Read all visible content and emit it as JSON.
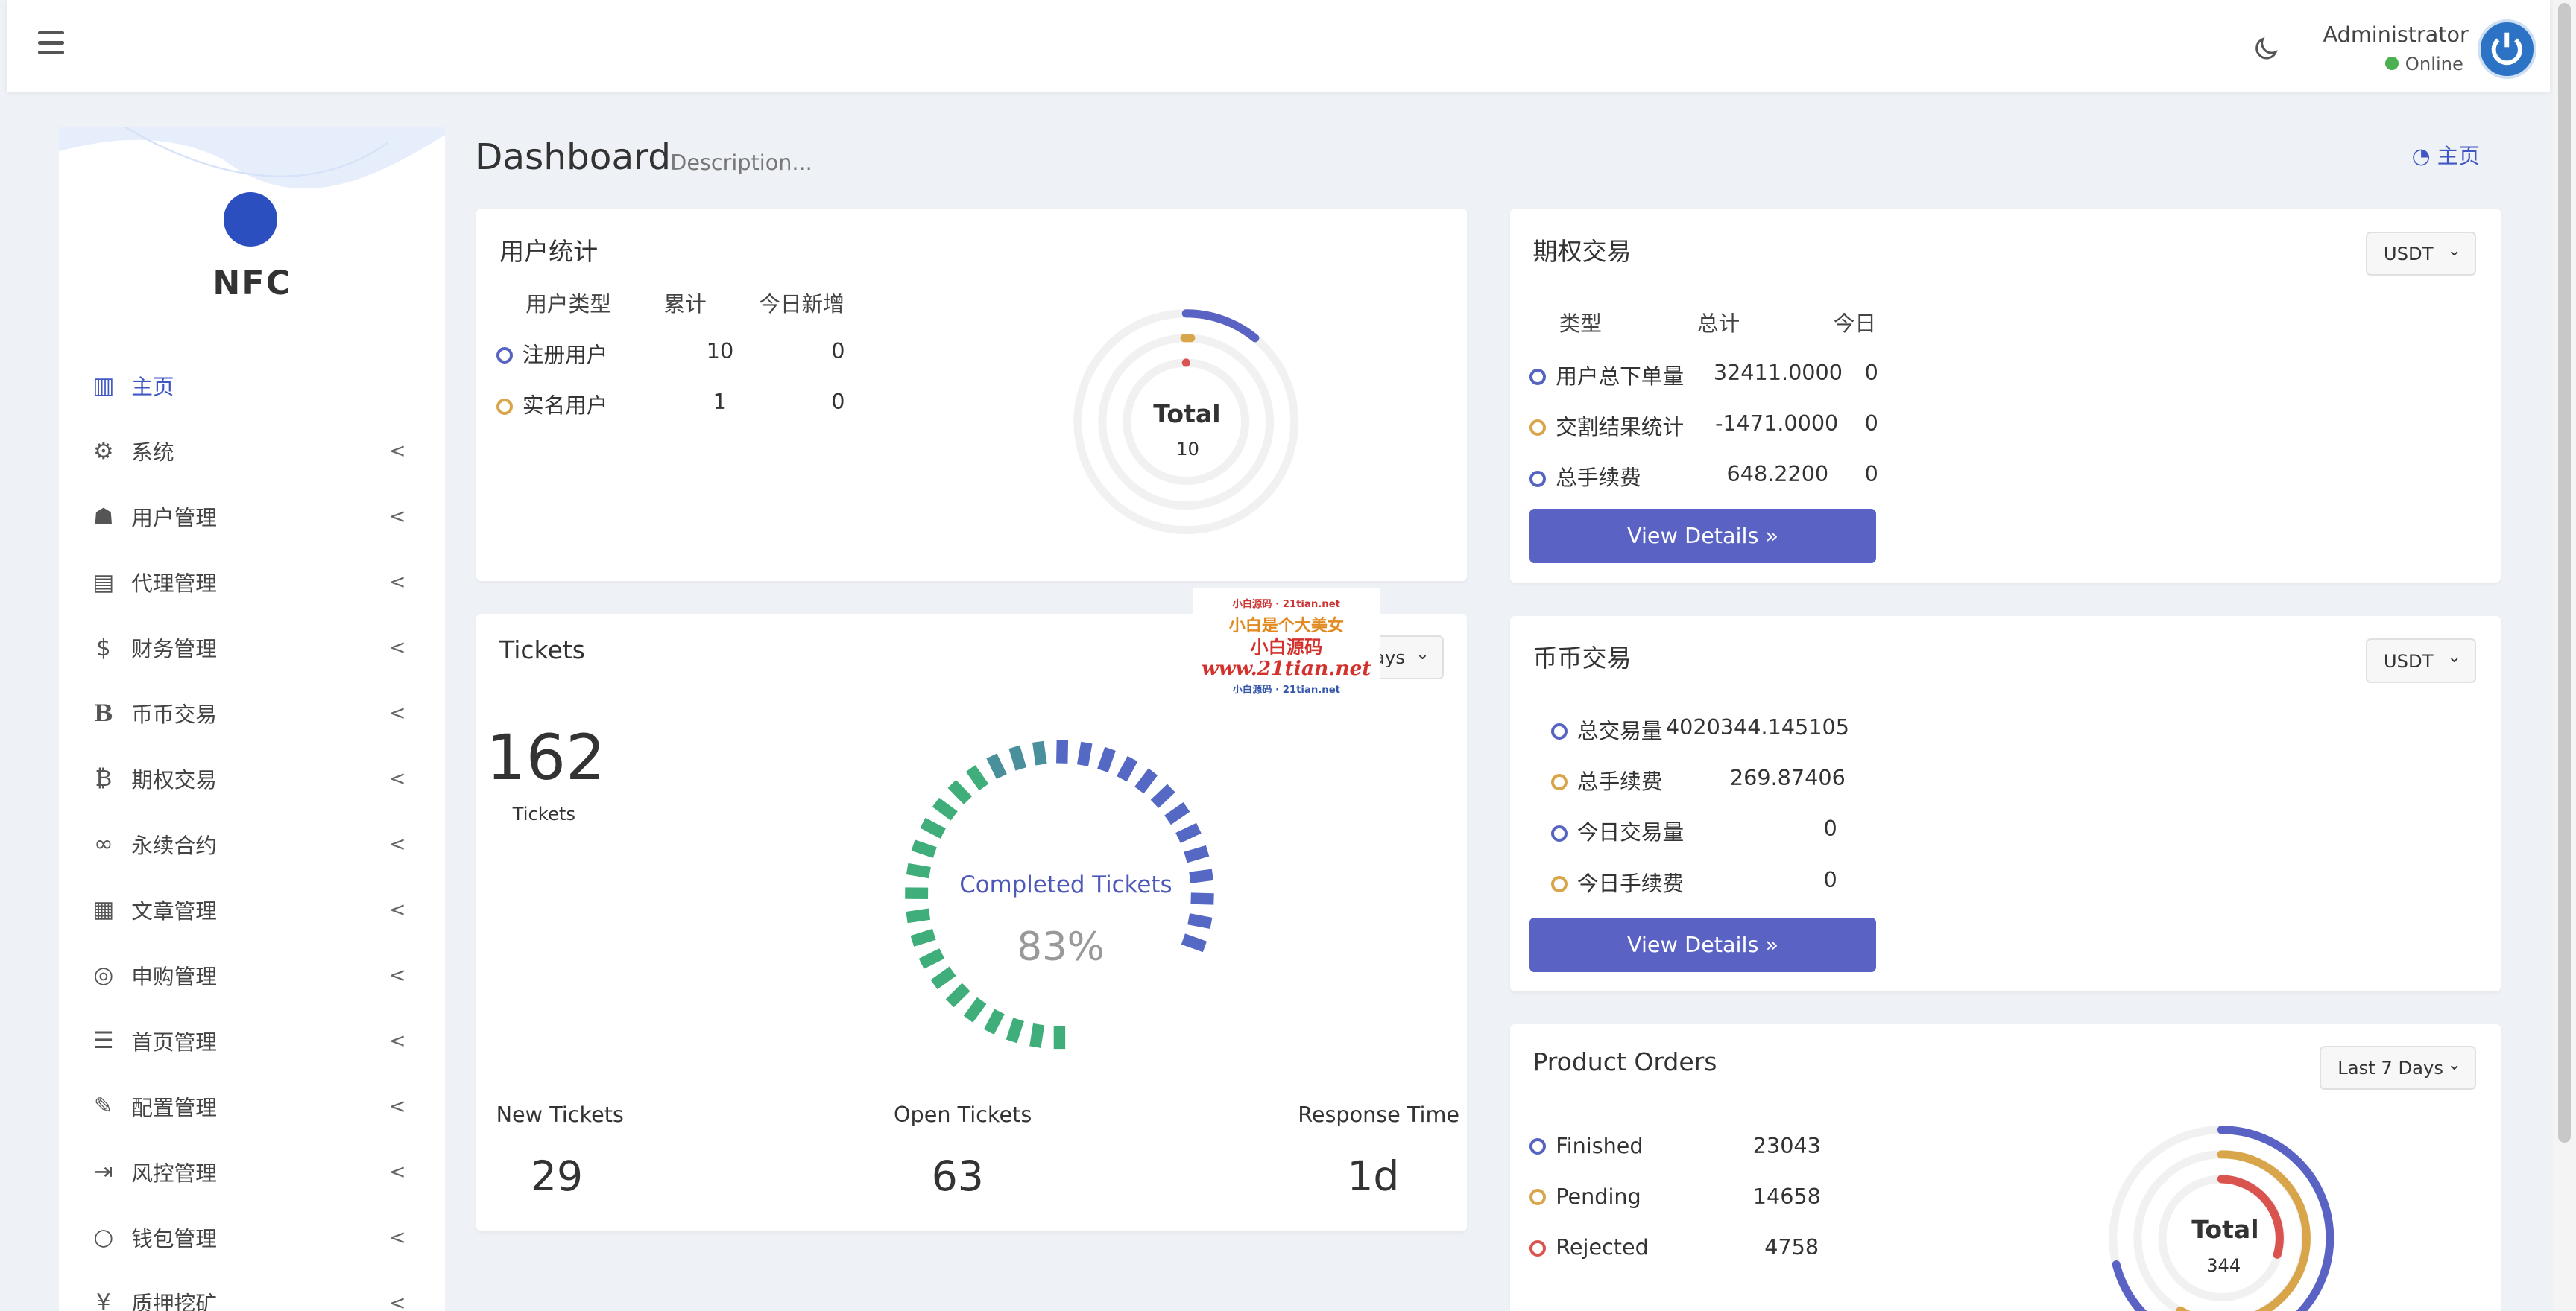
{
  "header": {
    "user_name": "Administrator",
    "user_status": "Online"
  },
  "sidebar": {
    "logo_text": "NFC",
    "items": [
      {
        "label": "主页",
        "icon": "bar-chart-icon",
        "active": true
      },
      {
        "label": "系统",
        "icon": "gear-icon"
      },
      {
        "label": "用户管理",
        "icon": "user-icon"
      },
      {
        "label": "代理管理",
        "icon": "id-card-icon"
      },
      {
        "label": "财务管理",
        "icon": "dollar-icon"
      },
      {
        "label": "币币交易",
        "icon": "b-icon"
      },
      {
        "label": "期权交易",
        "icon": "bitcoin-icon"
      },
      {
        "label": "永续合约",
        "icon": "link-icon"
      },
      {
        "label": "文章管理",
        "icon": "newspaper-icon"
      },
      {
        "label": "申购管理",
        "icon": "lifebuoy-icon"
      },
      {
        "label": "首页管理",
        "icon": "list-icon"
      },
      {
        "label": "配置管理",
        "icon": "wrench-icon"
      },
      {
        "label": "风控管理",
        "icon": "indent-icon"
      },
      {
        "label": "钱包管理",
        "icon": "circle-icon"
      },
      {
        "label": "质押挖矿",
        "icon": "yen-icon"
      }
    ]
  },
  "page": {
    "title": "Dashboard",
    "description": "Description...",
    "breadcrumb": "主页"
  },
  "user_stats": {
    "title": "用户统计",
    "headers": [
      "用户类型",
      "累计",
      "今日新增"
    ],
    "rows": [
      {
        "label": "注册用户",
        "total": "10",
        "today": "0"
      },
      {
        "label": "实名用户",
        "total": "1",
        "today": "0"
      }
    ],
    "donut_label": "Total",
    "donut_value": "10"
  },
  "options_trading": {
    "title": "期权交易",
    "currency": "USDT",
    "headers": [
      "类型",
      "总计",
      "今日"
    ],
    "rows": [
      {
        "label": "用户总下单量",
        "total": "32411.0000",
        "today": "0"
      },
      {
        "label": "交割结果统计",
        "total": "-1471.0000",
        "today": "0"
      },
      {
        "label": "总手续费",
        "total": "648.2200",
        "today": "0"
      }
    ],
    "button": "View Details"
  },
  "tickets": {
    "title": "Tickets",
    "range": "Last 7 Days",
    "count": "162",
    "count_label": "Tickets",
    "gauge_label": "Completed Tickets",
    "gauge_value": "83%",
    "gauge_fraction": 0.83,
    "stats": [
      {
        "label": "New Tickets",
        "value": "29"
      },
      {
        "label": "Open Tickets",
        "value": "63"
      },
      {
        "label": "Response Time",
        "value": "1d"
      }
    ]
  },
  "spot_trading": {
    "title": "币币交易",
    "currency": "USDT",
    "rows": [
      {
        "label": "总交易量",
        "value": "4020344.145105"
      },
      {
        "label": "总手续费",
        "value": "269.87406"
      },
      {
        "label": "今日交易量",
        "value": "0"
      },
      {
        "label": "今日手续费",
        "value": "0"
      }
    ],
    "button": "View Details"
  },
  "product_orders": {
    "title": "Product Orders",
    "range": "Last 7 Days",
    "rows": [
      {
        "label": "Finished",
        "value": "23043"
      },
      {
        "label": "Pending",
        "value": "14658"
      },
      {
        "label": "Rejected",
        "value": "4758"
      }
    ],
    "donut_label": "Total",
    "donut_value": "344"
  },
  "watermark": {
    "line1": "小白是个大美女",
    "line2": "小白源码",
    "line3": "www.21tian.net"
  },
  "colors": {
    "accent": "#5a63c4",
    "orange": "#d9a54a",
    "red": "#d9534f",
    "teal": "#4a9c8c"
  }
}
